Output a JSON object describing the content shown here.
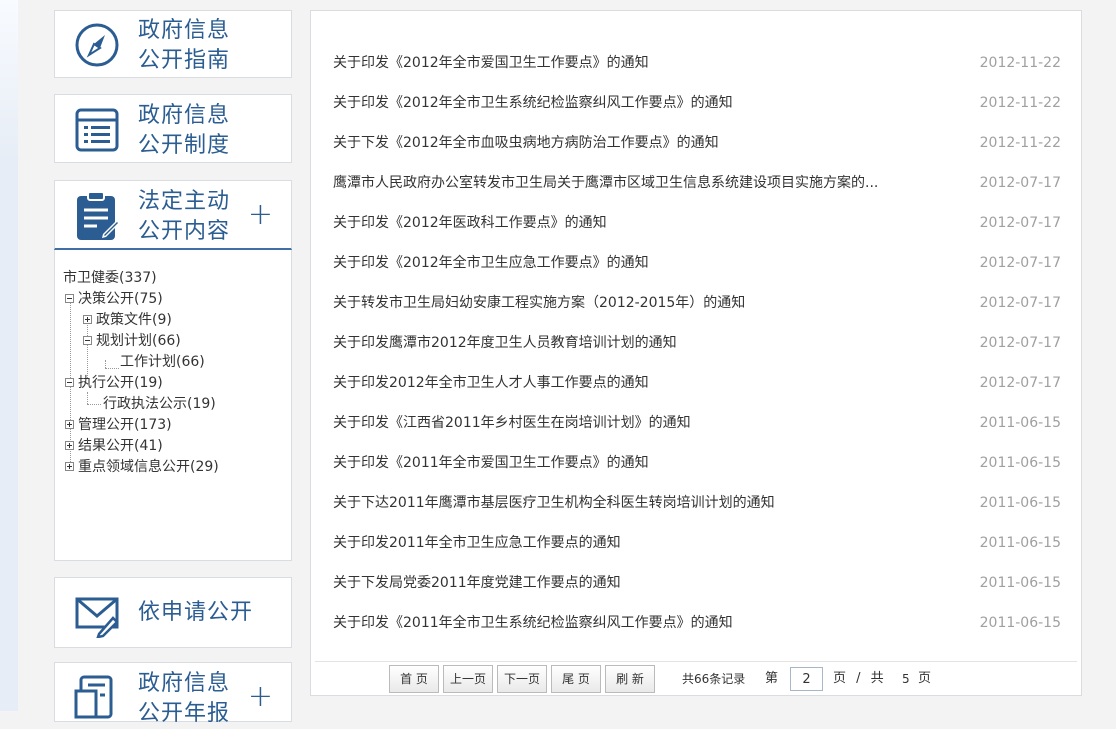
{
  "colors": {
    "accent": "#2b5d92",
    "date": "#a0a0a0",
    "text": "#333333"
  },
  "sidebar": {
    "guide": {
      "line1": "政府信息",
      "line2": "公开指南",
      "icon": "compass-icon"
    },
    "system": {
      "line1": "政府信息",
      "line2": "公开制度",
      "icon": "list-icon"
    },
    "active": {
      "line1": "法定主动",
      "line2": "公开内容",
      "icon": "clipboard-edit-icon",
      "expand": "+"
    },
    "apply": {
      "line1": "依申请公开",
      "icon": "envelope-pen-icon"
    },
    "annual": {
      "line1": "政府信息",
      "line2": "公开年报",
      "icon": "report-icon",
      "expand": "+"
    }
  },
  "tree": {
    "root": "市卫健委(337)",
    "items": [
      "决策公开(75)",
      "政策文件(9)",
      "规划计划(66)",
      "工作计划(66)",
      "执行公开(19)",
      "行政执法公示(19)",
      "管理公开(173)",
      "结果公开(41)",
      "重点领域信息公开(29)"
    ]
  },
  "documents": [
    {
      "title": "关于印发《2012年全市爱国卫生工作要点》的通知",
      "date": "2012-11-22"
    },
    {
      "title": "关于印发《2012年全市卫生系统纪检监察纠风工作要点》的通知",
      "date": "2012-11-22"
    },
    {
      "title": "关于下发《2012年全市血吸虫病地方病防治工作要点》的通知",
      "date": "2012-11-22"
    },
    {
      "title": "鹰潭市人民政府办公室转发市卫生局关于鹰潭市区域卫生信息系统建设项目实施方案的...",
      "date": "2012-07-17"
    },
    {
      "title": "关于印发《2012年医政科工作要点》的通知",
      "date": "2012-07-17"
    },
    {
      "title": "关于印发《2012年全市卫生应急工作要点》的通知",
      "date": "2012-07-17"
    },
    {
      "title": "关于转发市卫生局妇幼安康工程实施方案（2012-2015年）的通知",
      "date": "2012-07-17"
    },
    {
      "title": "关于印发鹰潭市2012年度卫生人员教育培训计划的通知",
      "date": "2012-07-17"
    },
    {
      "title": "关于印发2012年全市卫生人才人事工作要点的通知",
      "date": "2012-07-17"
    },
    {
      "title": "关于印发《江西省2011年乡村医生在岗培训计划》的通知",
      "date": "2011-06-15"
    },
    {
      "title": "关于印发《2011年全市爱国卫生工作要点》的通知",
      "date": "2011-06-15"
    },
    {
      "title": "关于下达2011年鹰潭市基层医疗卫生机构全科医生转岗培训计划的通知",
      "date": "2011-06-15"
    },
    {
      "title": "关于印发2011年全市卫生应急工作要点的通知",
      "date": "2011-06-15"
    },
    {
      "title": "关于下发局党委2011年度党建工作要点的通知",
      "date": "2011-06-15"
    },
    {
      "title": "关于印发《2011年全市卫生系统纪检监察纠风工作要点》的通知",
      "date": "2011-06-15"
    }
  ],
  "pager": {
    "first": "首 页",
    "prev": "上一页",
    "next": "下一页",
    "last": "尾 页",
    "refresh": "刷 新",
    "total_text": "共66条记录",
    "page_prefix": "第",
    "current_page": "2",
    "page_suffix": "页 / 共",
    "total_pages": "5",
    "pages_suffix": "页"
  }
}
